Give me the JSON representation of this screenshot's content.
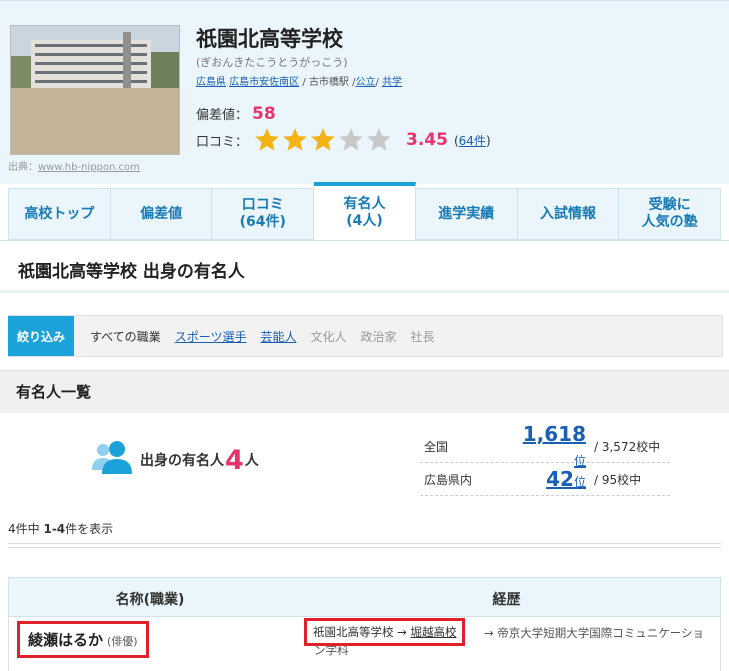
{
  "school": {
    "name": "祇園北高等学校",
    "reading": "(ぎおんきたこうとうがっこう)",
    "prefecture": "広島県",
    "district": "広島市安佐南区",
    "station": "古市橋駅",
    "type1": "公立",
    "type2": "共学",
    "photo_credit_prefix": "出典：",
    "photo_credit_link": "www.hb-nippon.com"
  },
  "hensachi": {
    "label": "偏差値：",
    "value": "58"
  },
  "review": {
    "label": "口コミ：",
    "rating": 3.45,
    "score": "3.45",
    "count_link": "64件",
    "stars_total": 5
  },
  "tabs": [
    {
      "label": "高校トップ"
    },
    {
      "label": "偏差値"
    },
    {
      "label": "口コミ\n(64件)"
    },
    {
      "label": "有名人\n(4人)"
    },
    {
      "label": "進学実績"
    },
    {
      "label": "入試情報"
    },
    {
      "label": "受験に\n人気の塾"
    }
  ],
  "page_title": "祇園北高等学校 出身の有名人",
  "filter": {
    "button": "絞り込み",
    "all": "すべての職業",
    "items": [
      {
        "label": "スポーツ選手",
        "link": true
      },
      {
        "label": "芸能人",
        "link": true
      },
      {
        "label": "文化人",
        "link": false
      },
      {
        "label": "政治家",
        "link": false
      },
      {
        "label": "社長",
        "link": false
      }
    ]
  },
  "section_title": "有名人一覧",
  "count": {
    "label": "出身の有名人",
    "value": "4",
    "unit": "人"
  },
  "ranking": [
    {
      "area": "全国",
      "rank": "1,618",
      "unit": "位",
      "total": "/ 3,572校中"
    },
    {
      "area": "広島県内",
      "rank": "42",
      "unit": "位",
      "total": "/ 95校中"
    }
  ],
  "showing": {
    "prefix": "4",
    "mid": "件中 ",
    "range": "1-4",
    "suffix": "件を表示"
  },
  "table": {
    "col_name": "名称(職業)",
    "col_career": "経歴",
    "rows": [
      {
        "name": "綾瀬はるか",
        "job": "(俳優)",
        "career_school": "祇園北高等学校",
        "arrow": "→",
        "career_link": "堀越高校",
        "career_rest": "→ 帝京大学短期大学国際コミュニケーション学科"
      }
    ]
  },
  "colors": {
    "accent": "#1ba3d9",
    "pink": "#e8336d",
    "link": "#1a5fb4",
    "highlight": "#e0202a"
  }
}
